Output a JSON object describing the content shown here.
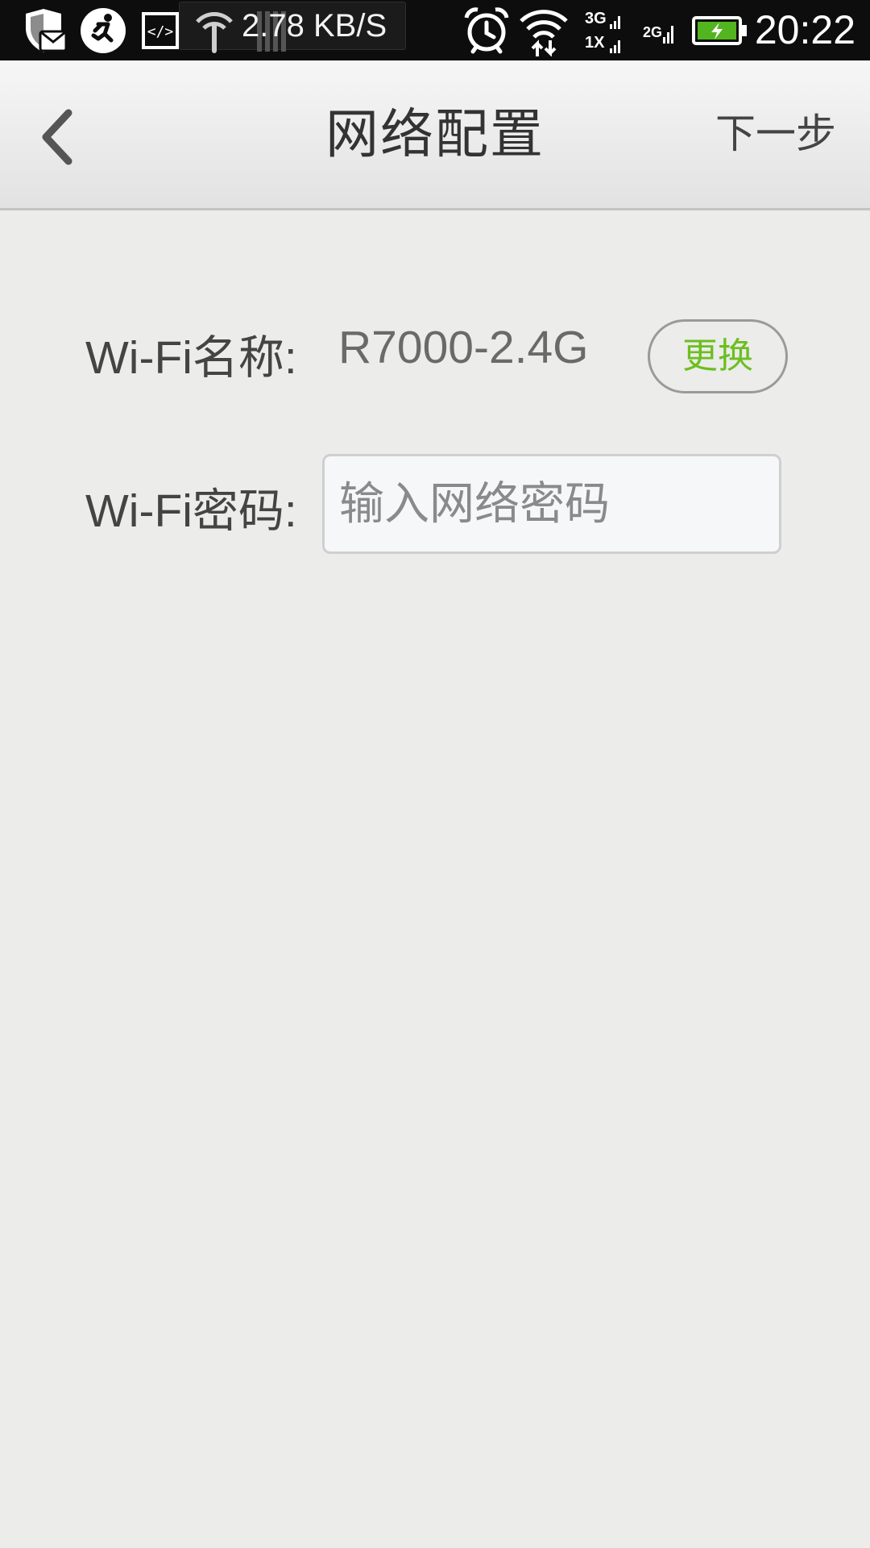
{
  "status_bar": {
    "net_speed": "2.78 KB/S",
    "time": "20:22",
    "network_3g": "3G",
    "network_1x": "1X",
    "network_2g": "2G",
    "icons": [
      "shield-mail-icon",
      "runner-icon",
      "code-icon",
      "wifi-usb-icon",
      "alarm-icon",
      "wifi-icon",
      "signal-3g-icon",
      "signal-1x-icon",
      "signal-2g-icon",
      "battery-charging-icon"
    ],
    "battery_color": "#52b520"
  },
  "header": {
    "title": "网络配置",
    "next_label": "下一步",
    "back_icon": "chevron-left-icon"
  },
  "form": {
    "ssid_label": "Wi-Fi名称:",
    "ssid_value": "R7000-2.4G",
    "change_label": "更换",
    "password_label": "Wi-Fi密码:",
    "password_placeholder": "输入网络密码",
    "password_value": ""
  },
  "colors": {
    "accent_green": "#6bbf1f",
    "background": "#ececea",
    "status_bar": "#0d0d0d"
  }
}
